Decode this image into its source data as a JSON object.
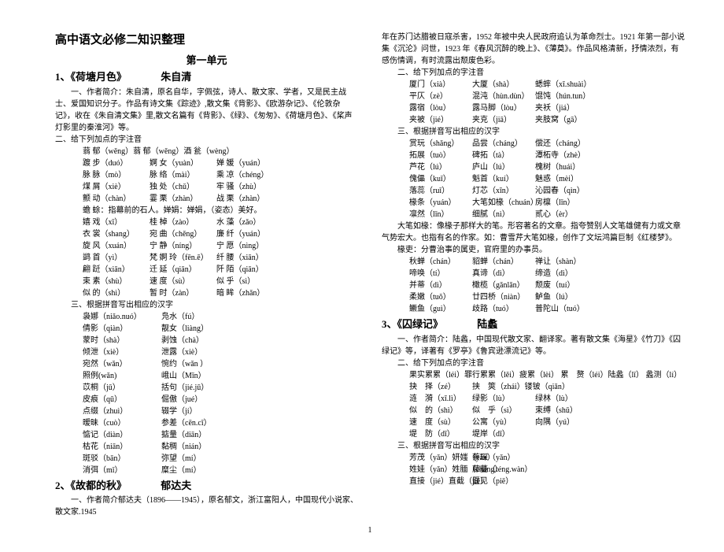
{
  "title": "高中语文必修二知识整理",
  "unit": "第一单元",
  "footer_page": "1",
  "s1": {
    "heading": "1、《荷塘月色》",
    "author": "朱自清",
    "intro1": "一、作者简介：朱自清，原名自华，字佩弦，诗人、散文家、学者，又是民主战士、爱国知识分子。作品有诗文集《踪迹》,散文集《背影》、《欧游杂记》、《伦敦杂记》，收在《朱自清文集》里,散文名篇有《背影》、《绿》、《匆匆》、《荷塘月色》、《桨声灯影里的秦淮河》等。",
    "h2": "二、给下列加点的字注音",
    "pinyin": [
      [
        "蓊 郁（wěng）蓊 郁（wěng）酒 瓮（wèng）"
      ],
      [
        "踱 步（duó）",
        "婀 女（yuàn）",
        "婵 媛（yuán）"
      ],
      [
        "脉 脉（mò）",
        "脉 络（mài）",
        "乘 凉（chéng）"
      ],
      [
        "煤 屑（xiè）",
        "独 处（chǔ）",
        "牢 骚（zhù）"
      ],
      [
        "颤 动（chàn）",
        "霎 栗（zhàn）",
        "战 栗（zhàn）"
      ],
      [
        "蟾 蜍：指幕前的石人。婵娟：婵娟，（姿态）美好。"
      ],
      [
        "嬉 戏（xī）",
        "桂 棹（zào）",
        "水 藻（zǎo）"
      ],
      [
        "衣 裳（shang）",
        "宛 曲（chěng）",
        "廉 纤（yuán）"
      ],
      [
        "旋 风（xuán）",
        "宁 静（níng）",
        "宁 愿（nìng）"
      ],
      [
        "鹢 首（yì）",
        "梵 婀 玲（fēn.ē）",
        "纤 腰（xiān）"
      ],
      [
        "翩 跹（xiān）",
        "迁 延（qiān）",
        "阡 陌（qiān）"
      ],
      [
        "束 素（shù）",
        "速 度（sù）",
        "似 乎（sì）"
      ],
      [
        "似 的（shì）",
        "暂 时（zàn）",
        "暗 眸（zhǎn）"
      ]
    ],
    "h3": "三、根据拼音写出相应的汉字",
    "hanzi": [
      [
        "袅娜（niǎo.nuó）",
        "凫水（fú）"
      ],
      [
        "倩影（qiàn）",
        "靓女（liàng）"
      ],
      [
        "蒙时（shà）",
        "剥蚀（chà）"
      ],
      [
        "倾泄（xiè）",
        "泄露（xiè）"
      ],
      [
        "宛然（wǎn）",
        "惋约（wǎn ）"
      ],
      [
        "照例(wǎn)",
        "峨山（Mǐn）"
      ],
      [
        "苡桐（jū）",
        "括句（jié.jū）"
      ],
      [
        "皮痕（qū）",
        "倔傲（jué）"
      ],
      [
        "点缀（zhuì）",
        "辍学（jí）"
      ],
      [
        "暧昧（cuò）",
        "参差（cēn.cī）"
      ],
      [
        "惦记（diàn）",
        "掂量（diān）"
      ],
      [
        "枯花（niān）",
        "黏稠（nián）"
      ],
      [
        "斑驳（bān）",
        "弥望（mí）"
      ],
      [
        "消弭（mǐ）",
        "糜尘（mí）"
      ]
    ]
  },
  "s2": {
    "heading": "2、《故都的秋》",
    "author": "郁达夫",
    "intro": "一、作者简介郁达夫（1896——1945），原名郁文，浙江富阳人，中国现代小说家、散文家.1945",
    "cont": "年在苏门达腊被日寇杀害，1952 年被中央人民政府追认为革命烈士。1921 年第一部小说集《沉沦》问世，1923 年《春风沉醉的晚上》、《薄奠》。作品风格清新，抒情浓烈，有感伤情调，有时流露出颓废色彩。",
    "h2": "二、给下列加点的字注音",
    "pinyin": [
      [
        "厦门（xià）",
        "大厦（shà）",
        "蟋蟀（xī.shuài）"
      ],
      [
        "平仄（zè）",
        "混沌（hùn.dùn）",
        "馄饨（hún.tun）"
      ],
      [
        "露宿（lòu）",
        "露马脚（lòu）",
        "夹袄（jiá）"
      ],
      [
        "夹被（jié）",
        "夹克（jiā）",
        "夹肢窝（gā）"
      ]
    ],
    "h3": "三、根据拼音写出相应的汉字",
    "hanzi": [
      [
        "赏玩（shǎng）",
        "品尝（cháng）",
        "偿还（cháng）"
      ],
      [
        "拓展（tuò）",
        "碑拓（tà）",
        "潭柘寺（zhè）"
      ],
      [
        "芦花（lú）",
        "庐山（lú）",
        "槐树（huái）"
      ],
      [
        "傀儡（kuǐ）",
        "魁首（kuí）",
        "魅惑（mèi）"
      ],
      [
        "落蕊（ruǐ）",
        "灯芯（xīn）",
        "沁园春（qìn）"
      ],
      [
        "椽条（yuán）",
        "大笔如椽（chuán）",
        "房檩（lǐn）"
      ],
      [
        "凛然（lǐn）",
        "细腻（nì）",
        "贰心（èr）"
      ]
    ],
    "note1": "大笔如椽：像椽子那样大的笔。形容著名的文章。指夸赞别人文笔雄健有力或文章气势宏大。也指有名的作家。如：曹雪芹大笔如椽，创作了文坛鸿篇巨制《红楼梦》。",
    "note2": "椽吏：分曹治事的属吏，官府里的办事员。",
    "words": [
      [
        "秋蝉（chán）",
        "貂蝉（chán）",
        "禅让（shàn）"
      ],
      [
        "啼唤（tí）",
        "真谛（dì）",
        "缔造（dì）"
      ],
      [
        "并蒂（dì）　",
        "橄榄（gǎnlǎn）",
        "颓废（tuí）"
      ],
      [
        "柔嫩（tuǒ）",
        "廿四桥（niàn）",
        "鲈鱼（lú）"
      ],
      [
        "鳜鱼（guì）",
        "歧路（tuó）",
        "普陀山（tuó）"
      ]
    ]
  },
  "s3": {
    "heading": "3、《囚绿记》",
    "author": "陆蠡",
    "intro": "一、作者简介：陆蠡，中国现代散文家、翻译家。著有散文集《海星》《竹刀》《囚绿记》等，译著有《罗亭》《鲁宾逊漂流记》等。",
    "h2": "二、给下列加点的字注音",
    "pinyin": [
      [
        "果实累累（léi）罪行累累（lěi）疲累（lèi）   累　赘（léi）陆蠡（lǐ）  蠡测（lí）"
      ],
      [
        "抉　择（zé）",
        "挟　筴（zhái）镂铍（qiǎn）"
      ],
      [
        "涟　漪（xī.lì）",
        "绿影（lù）",
        "绿林（lù）"
      ],
      [
        "似　的（shì）",
        "似　乎（sì）",
        "束缚（shǔ）"
      ],
      [
        "速　度（sù）",
        "公寓（yù）",
        "向隅（yú）"
      ],
      [
        "堤　防（dī）",
        "堤岸（dī）",
        ""
      ]
    ],
    "h3": "三、根据拼音写出相应的汉字",
    "hanzi": [
      [
        "芳茂（yǎn）妍媸（yǎn）",
        "蔡琛（yǎn）"
      ],
      [
        "姓娃（yǎn）姓腼（cháng）",
        "藤蔓（téng.wàn）"
      ],
      [
        "直接（jié）直截（jié）",
        "暨见（piē）"
      ]
    ]
  }
}
